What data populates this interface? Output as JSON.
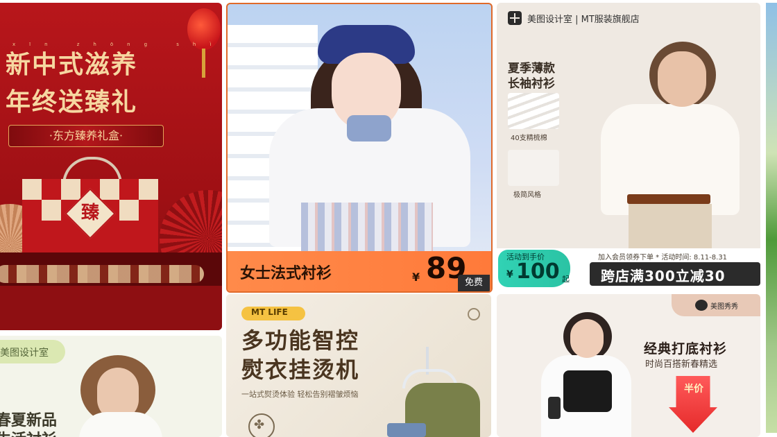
{
  "card1": {
    "pinyin": "xīn zhōng shì zī yǎng",
    "title_line1": "新中式滋养",
    "title_line2": "年终送臻礼",
    "ribbon": "·东方臻养礼盒·",
    "box_char": "臻"
  },
  "card2": {
    "product_name": "女士法式衬衫",
    "currency": "¥",
    "price": "89",
    "free_label": "免费"
  },
  "card3": {
    "brand": "美图设计室 | MT服装旗舰店",
    "headline_line1": "夏季薄款",
    "headline_line2": "长袖衬衫",
    "swatch1_label": "40支精梳棉",
    "swatch2_label": "极简风格",
    "pill_label": "活动到手价",
    "pill_currency": "¥",
    "pill_price": "100",
    "pill_suffix": "起",
    "info": "加入会员领券下单 * 活动时间: 8.11-8.31",
    "promo": "跨店满300立减30"
  },
  "card4": {
    "tag": "美图设计室",
    "line1": "春夏新品",
    "line2": "生活衬衫"
  },
  "card5": {
    "badge": "MT LIFE",
    "headline_line1": "多功能智控",
    "headline_line2": "熨衣挂烫机",
    "subtitle": "一站式熨烫体验 轻松告别褶皱烦恼",
    "icon": "fan-icon"
  },
  "card6": {
    "brand": "美图秀秀",
    "headline": "经典打底衬衫",
    "subtitle": "时尚百搭新春精选",
    "arrow_text": "半价"
  },
  "colors": {
    "card1_bg": "#b8161b",
    "card2_border": "#e06a2a",
    "card2_band": "#ff8a4a",
    "card3_pill": "#31d2b4",
    "card3_promo_bg": "#2b2b2b",
    "card5_badge": "#f5c242",
    "card6_arrow": "#e52a2a"
  }
}
